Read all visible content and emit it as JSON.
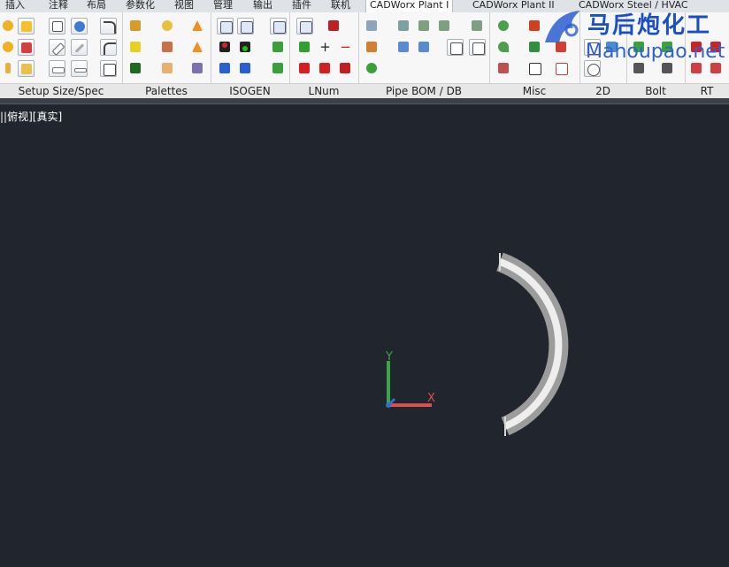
{
  "menu_tabs": [
    "插入",
    "注释",
    "布局",
    "参数化",
    "视图",
    "管理",
    "输出",
    "插件",
    "联机",
    "CADWorx Plant I",
    "CADWorx Plant II",
    "CADWorx Steel / HVAC"
  ],
  "active_tab": "CADWorx Plant I",
  "panels": [
    "Setup Size/Spec",
    "Palettes",
    "ISOGEN",
    "LNum",
    "Pipe BOM / DB",
    "Misc",
    "2D",
    "Bolt",
    "RT"
  ],
  "view_label": "||俯视][真实]",
  "watermark": {
    "title": "马后炮化工",
    "url": "Mahoupao.net"
  },
  "ucs": {
    "x_label": "X",
    "y_label": "Y"
  },
  "icons": {
    "setup": [
      "setup-icon",
      "book-icon",
      "setup-flag-icon",
      "reducer-icon",
      "ruler-icon",
      "bend-icon",
      "spec-edit-icon"
    ],
    "palettes": [
      "spc-palette-icon",
      "grid-palette-icon",
      "map-palette-icon"
    ],
    "isogen": [
      "iso-icon",
      "iso-config-icon",
      "pcf-out-icon",
      "pcf-in-icon"
    ],
    "lnum": [
      "lnum-icon",
      "113-icon",
      "plus-icon",
      "minus-icon"
    ],
    "colors": {
      "accent_red": "#d42020",
      "accent_green": "#2aa02a",
      "accent_blue": "#2a5fd0",
      "accent_yellow": "#e8c020"
    }
  }
}
